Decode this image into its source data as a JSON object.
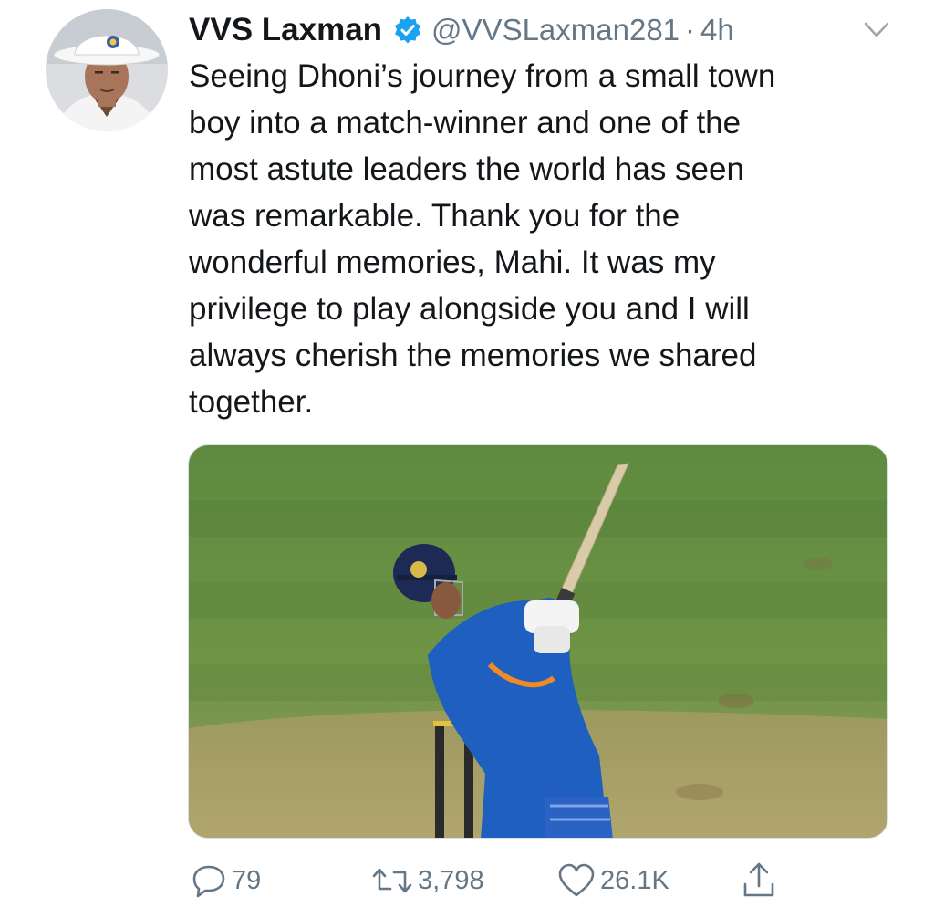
{
  "author": {
    "name": "VVS Laxman",
    "handle": "@VVSLaxman281",
    "separator": "·",
    "time": "4h"
  },
  "tweet": {
    "text": "Seeing Dhoni’s journey from a small town\nboy into a match-winner and one of the\nmost astute leaders the world has seen\nwas remarkable. Thank you for the\nwonderful memories, Mahi. It was my\nprivilege to play alongside you and I will\nalways cherish the memories we shared\ntogether."
  },
  "actions": {
    "reply_count": "79",
    "retweet_count": "3,798",
    "like_count": "26.1K"
  },
  "icons": {
    "verified": "verified-badge-icon",
    "caret": "chevron-down-icon",
    "reply": "reply-icon",
    "retweet": "retweet-icon",
    "like": "heart-icon",
    "share": "share-icon"
  },
  "colors": {
    "text": "#14171a",
    "secondary": "#657786",
    "verified_blue": "#1da1f2",
    "pitch_green": "#4f7d3a",
    "jersey_blue": "#1e5fbf"
  }
}
